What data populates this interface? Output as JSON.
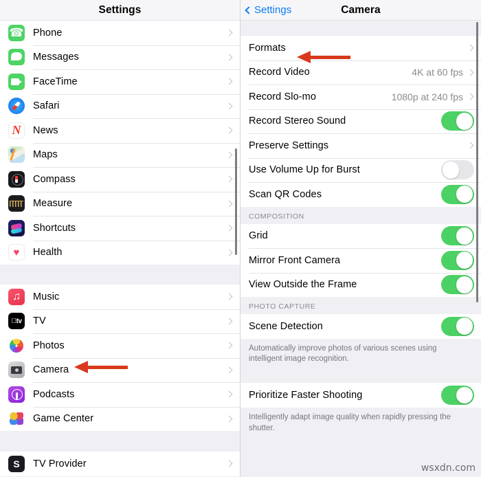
{
  "left_panel": {
    "nav": {
      "title": "Settings"
    },
    "groups": [
      {
        "items": [
          {
            "label": "Phone",
            "icon": "phone-icon",
            "accessory": "chevron"
          },
          {
            "label": "Messages",
            "icon": "messages-icon",
            "accessory": "chevron"
          },
          {
            "label": "FaceTime",
            "icon": "facetime-icon",
            "accessory": "chevron"
          },
          {
            "label": "Safari",
            "icon": "safari-icon",
            "accessory": "chevron"
          },
          {
            "label": "News",
            "icon": "news-icon",
            "accessory": "chevron"
          },
          {
            "label": "Maps",
            "icon": "maps-icon",
            "accessory": "chevron"
          },
          {
            "label": "Compass",
            "icon": "compass-icon",
            "accessory": "chevron"
          },
          {
            "label": "Measure",
            "icon": "measure-icon",
            "accessory": "chevron"
          },
          {
            "label": "Shortcuts",
            "icon": "shortcuts-icon",
            "accessory": "chevron"
          },
          {
            "label": "Health",
            "icon": "health-icon",
            "accessory": "chevron"
          }
        ]
      },
      {
        "items": [
          {
            "label": "Music",
            "icon": "music-icon",
            "accessory": "chevron"
          },
          {
            "label": "TV",
            "icon": "tv-icon",
            "accessory": "chevron"
          },
          {
            "label": "Photos",
            "icon": "photos-icon",
            "accessory": "chevron"
          },
          {
            "label": "Camera",
            "icon": "camera-icon",
            "accessory": "chevron"
          },
          {
            "label": "Podcasts",
            "icon": "podcasts-icon",
            "accessory": "chevron"
          },
          {
            "label": "Game Center",
            "icon": "game-center-icon",
            "accessory": "chevron"
          }
        ]
      },
      {
        "items": [
          {
            "label": "TV Provider",
            "icon": "tv-provider-icon",
            "accessory": "chevron"
          }
        ]
      }
    ]
  },
  "right_panel": {
    "nav": {
      "back_label": "Settings",
      "title": "Camera"
    },
    "groups": [
      {
        "header": "",
        "items": [
          {
            "label": "Formats",
            "type": "chevron"
          },
          {
            "label": "Record Video",
            "type": "value",
            "value": "4K at 60 fps"
          },
          {
            "label": "Record Slo-mo",
            "type": "value",
            "value": "1080p at 240 fps"
          },
          {
            "label": "Record Stereo Sound",
            "type": "toggle",
            "on": true
          },
          {
            "label": "Preserve Settings",
            "type": "chevron"
          },
          {
            "label": "Use Volume Up for Burst",
            "type": "toggle",
            "on": false
          },
          {
            "label": "Scan QR Codes",
            "type": "toggle",
            "on": true
          }
        ],
        "footer": ""
      },
      {
        "header": "COMPOSITION",
        "items": [
          {
            "label": "Grid",
            "type": "toggle",
            "on": true
          },
          {
            "label": "Mirror Front Camera",
            "type": "toggle",
            "on": true
          },
          {
            "label": "View Outside the Frame",
            "type": "toggle",
            "on": true
          }
        ],
        "footer": ""
      },
      {
        "header": "PHOTO CAPTURE",
        "items": [
          {
            "label": "Scene Detection",
            "type": "toggle",
            "on": true
          }
        ],
        "footer": "Automatically improve photos of various scenes using intelligent image recognition."
      },
      {
        "header": "",
        "items": [
          {
            "label": "Prioritize Faster Shooting",
            "type": "toggle",
            "on": true
          }
        ],
        "footer": "Intelligently adapt image quality when rapidly pressing the shutter."
      }
    ]
  },
  "annotations": {
    "arrow_color": "#d8391c",
    "arrow_formats_target": "Formats",
    "arrow_camera_target": "Camera"
  },
  "watermark": {
    "text": "wsxdn.com"
  },
  "colors": {
    "toggle_on": "#4cd164",
    "toggle_off": "#e6e6e9",
    "group_bg": "#ffffff",
    "page_bg": "#efeff4",
    "nav_bg": "#f6f6f8",
    "accent_link": "#0b7cf6",
    "value_text": "#8b8b90",
    "header_text": "#8a8a8f"
  }
}
